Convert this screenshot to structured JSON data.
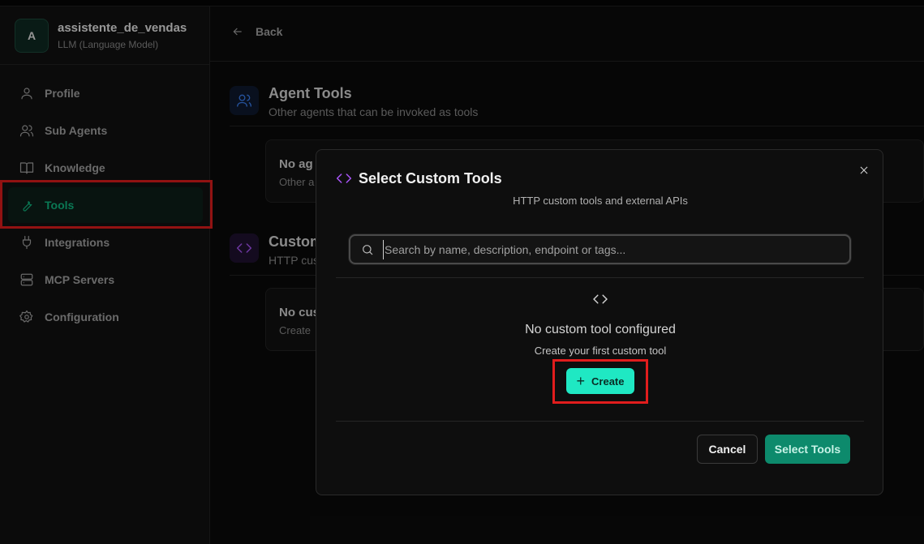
{
  "agent": {
    "initial": "A",
    "name": "assistente_de_vendas",
    "type": "LLM (Language Model)"
  },
  "sidebar": {
    "items": [
      {
        "label": "Profile",
        "icon": "user-icon"
      },
      {
        "label": "Sub Agents",
        "icon": "users-icon"
      },
      {
        "label": "Knowledge",
        "icon": "book-icon"
      },
      {
        "label": "Tools",
        "icon": "wrench-icon",
        "active": true
      },
      {
        "label": "Integrations",
        "icon": "plug-icon"
      },
      {
        "label": "MCP Servers",
        "icon": "server-icon"
      },
      {
        "label": "Configuration",
        "icon": "gear-icon"
      }
    ]
  },
  "topbar": {
    "back_label": "Back"
  },
  "sections": {
    "agent_tools": {
      "title": "Agent Tools",
      "subtitle": "Other agents that can be invoked as tools",
      "empty_title": "No ag",
      "empty_sub": "Other a"
    },
    "custom_tools": {
      "title": "Custom",
      "subtitle": "HTTP cust",
      "empty_title": "No cus",
      "empty_sub": "Create"
    }
  },
  "modal": {
    "title": "Select Custom Tools",
    "subtitle": "HTTP custom tools and external APIs",
    "search_placeholder": "Search by name, description, endpoint or tags...",
    "empty_title": "No custom tool configured",
    "empty_sub": "Create your first custom tool",
    "create_label": "Create",
    "cancel_label": "Cancel",
    "select_label": "Select Tools"
  },
  "colors": {
    "accent": "#10b981",
    "create_button": "#1fe8c3",
    "select_button": "#0d8a6c",
    "highlight": "#e11d1d",
    "code_icon": "#a855f7"
  }
}
